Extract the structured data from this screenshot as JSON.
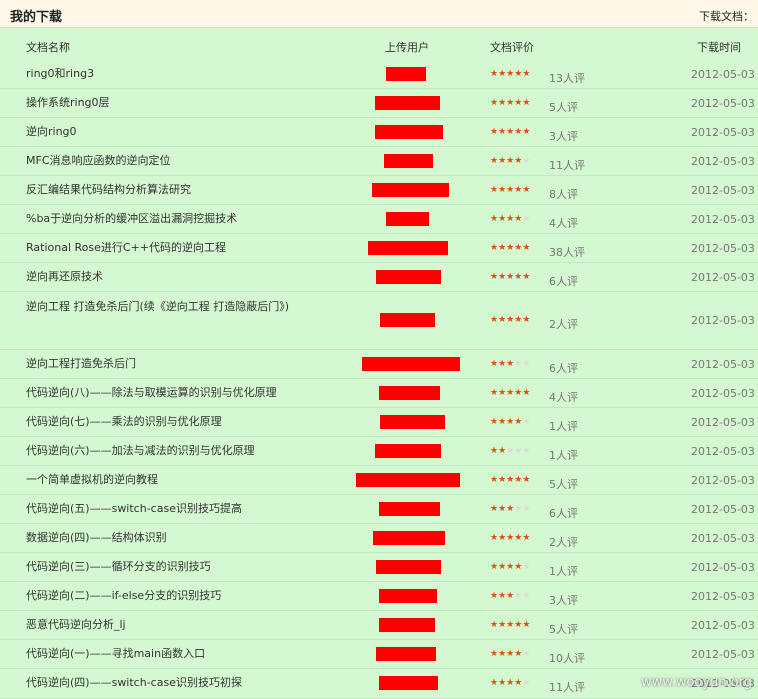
{
  "header": {
    "title": "我的下载",
    "downloads_label": "下载文档："
  },
  "columns": {
    "name": "文档名称",
    "user": "上传用户",
    "rating": "文档评价",
    "time": "下载时间"
  },
  "colors": {
    "redaction": "#ff0000",
    "star_on": "#e05010",
    "star_off": "#dcdcdc"
  },
  "rows": [
    {
      "name": "ring0和ring3",
      "stars": 5,
      "count": "13人评",
      "date": "2012-05-03"
    },
    {
      "name": "操作系统ring0层",
      "stars": 5,
      "count": "5人评",
      "date": "2012-05-03"
    },
    {
      "name": "逆向ring0",
      "stars": 5,
      "count": "3人评",
      "date": "2012-05-03"
    },
    {
      "name": "MFC消息响应函数的逆向定位",
      "stars": 4,
      "count": "11人评",
      "date": "2012-05-03"
    },
    {
      "name": "反汇编结果代码结构分析算法研究",
      "stars": 4.5,
      "count": "8人评",
      "date": "2012-05-03"
    },
    {
      "name": "%ba于逆向分析的缓冲区溢出漏洞挖掘技术",
      "stars": 4,
      "count": "4人评",
      "date": "2012-05-03"
    },
    {
      "name": "Rational Rose进行C++代码的逆向工程",
      "stars": 4.5,
      "count": "38人评",
      "date": "2012-05-03"
    },
    {
      "name": "逆向再还原技术",
      "stars": 4.5,
      "count": "6人评",
      "date": "2012-05-03"
    },
    {
      "name": "逆向工程  打造免杀后门(续《逆向工程  打造隐蔽后门》)",
      "stars": 5,
      "count": "2人评",
      "date": "2012-05-03"
    },
    {
      "name": "逆向工程打造免杀后门",
      "stars": 3,
      "count": "6人评",
      "date": "2012-05-03"
    },
    {
      "name": "代码逆向(八)——除法与取模运算的识别与优化原理",
      "stars": 5,
      "count": "4人评",
      "date": "2012-05-03"
    },
    {
      "name": "代码逆向(七)——乘法的识别与优化原理",
      "stars": 4,
      "count": "1人评",
      "date": "2012-05-03"
    },
    {
      "name": "代码逆向(六)——加法与减法的识别与优化原理",
      "stars": 2,
      "count": "1人评",
      "date": "2012-05-03"
    },
    {
      "name": "一个简单虚拟机的逆向教程",
      "stars": 5,
      "count": "5人评",
      "date": "2012-05-03"
    },
    {
      "name": "代码逆向(五)——switch-case识别技巧提高",
      "stars": 3,
      "count": "6人评",
      "date": "2012-05-03"
    },
    {
      "name": "数据逆向(四)——结构体识别",
      "stars": 4.5,
      "count": "2人评",
      "date": "2012-05-03"
    },
    {
      "name": "代码逆向(三)——循环分支的识别技巧",
      "stars": 4,
      "count": "1人评",
      "date": "2012-05-03"
    },
    {
      "name": "代码逆向(二)——if-else分支的识别技巧",
      "stars": 3,
      "count": "3人评",
      "date": "2012-05-03"
    },
    {
      "name": "恶意代码逆向分析_lj",
      "stars": 5,
      "count": "5人评",
      "date": "2012-05-03"
    },
    {
      "name": "代码逆向(一)——寻找main函数入口",
      "stars": 4,
      "count": "10人评",
      "date": "2012-05-03"
    },
    {
      "name": "代码逆向(四)——switch-case识别技巧初探",
      "stars": 4,
      "count": "11人评",
      "date": "2012-05-03"
    }
  ],
  "watermark": "www.wooyun.org"
}
